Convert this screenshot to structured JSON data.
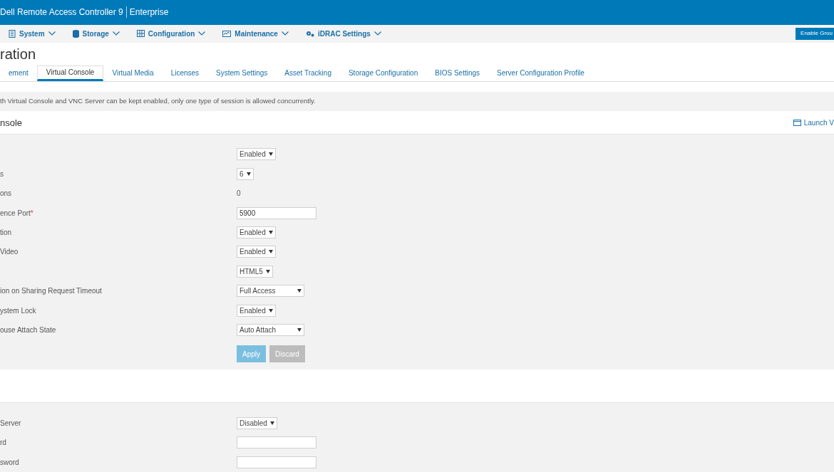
{
  "header": {
    "title": "Dell Remote Access Controller 9",
    "edition": "Enterprise"
  },
  "nav": {
    "items": [
      {
        "label": "System"
      },
      {
        "label": "Storage"
      },
      {
        "label": "Configuration"
      },
      {
        "label": "Maintenance"
      },
      {
        "label": "iDRAC Settings"
      }
    ],
    "action": "Enable Grou"
  },
  "page_title": "ration",
  "tabs": [
    {
      "label": "ement",
      "selected": false
    },
    {
      "label": "Virtual Console",
      "selected": true
    },
    {
      "label": "Virtual Media",
      "selected": false
    },
    {
      "label": "Licenses",
      "selected": false
    },
    {
      "label": "System Settings",
      "selected": false
    },
    {
      "label": "Asset Tracking",
      "selected": false
    },
    {
      "label": "Storage Configuration",
      "selected": false
    },
    {
      "label": "BIOS Settings",
      "selected": false
    },
    {
      "label": "Server Configuration Profile",
      "selected": false
    }
  ],
  "notice": "th Virtual Console and VNC Server can be kept enabled, only one type of session is allowed concurrently.",
  "section": {
    "title": "nsole",
    "link": "Launch V",
    "rows": [
      {
        "kind": "select",
        "value": "Enabled"
      },
      {
        "label": "s",
        "kind": "select",
        "value": "6"
      },
      {
        "label": "ons",
        "kind": "static",
        "value": "0"
      },
      {
        "label": "ence Port",
        "required_mark": "*",
        "kind": "input",
        "value": "5900"
      },
      {
        "label": "tion",
        "kind": "select",
        "value": "Enabled"
      },
      {
        "label": "Video",
        "kind": "select",
        "value": "Enabled"
      },
      {
        "kind": "select",
        "value": "HTML5"
      },
      {
        "label": "ion on Sharing Request Timeout",
        "kind": "select",
        "value": "Full Access"
      },
      {
        "label": "ystem Lock",
        "kind": "select",
        "value": "Enabled"
      },
      {
        "label": "ouse Attach State",
        "kind": "select",
        "value": "Auto Attach"
      }
    ],
    "buttons": [
      {
        "label": "Apply",
        "kind": "primary",
        "disabled": true
      },
      {
        "label": "Discard",
        "kind": "secondary",
        "disabled": true
      }
    ]
  },
  "vnc_rows": [
    {
      "label": "Server",
      "kind": "select",
      "value": "Disabled"
    },
    {
      "label": "rd",
      "kind": "input",
      "value": ""
    },
    {
      "label": "sword",
      "kind": "input",
      "value": ""
    }
  ]
}
